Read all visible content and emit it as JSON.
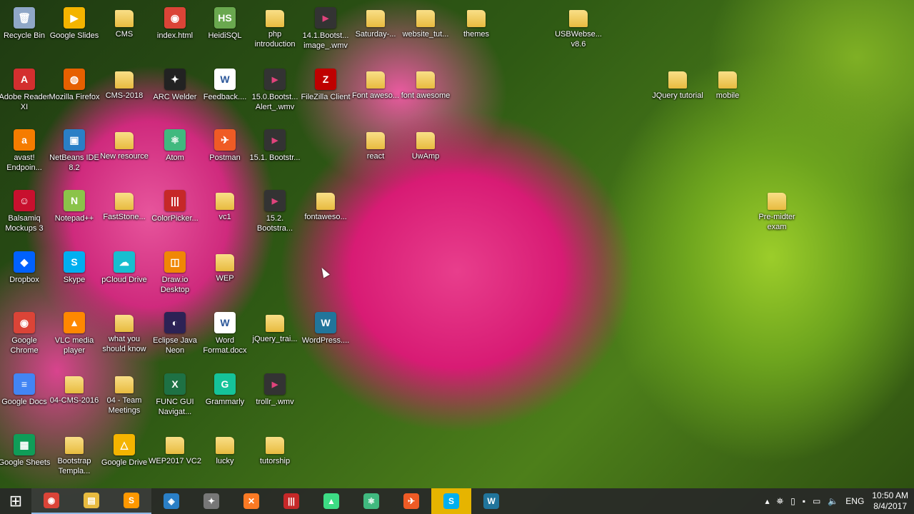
{
  "desktop_icons": [
    {
      "label": "Recycle Bin",
      "kind": "app",
      "glyph": "🗑",
      "color": "#8fa7c7"
    },
    {
      "label": "Google Slides",
      "kind": "app",
      "glyph": "▶",
      "color": "#f4b400"
    },
    {
      "label": "CMS",
      "kind": "folder"
    },
    {
      "label": "index.html",
      "kind": "app",
      "glyph": "◉",
      "color": "#db4437"
    },
    {
      "label": "HeidiSQL",
      "kind": "app",
      "glyph": "HS",
      "color": "#6aa84f"
    },
    {
      "label": "php introduction",
      "kind": "folder"
    },
    {
      "label": "14.1.Bootst... image_.wmv",
      "kind": "video",
      "glyph": "▶"
    },
    {
      "label": "Saturday-...",
      "kind": "folder"
    },
    {
      "label": "website_tut...",
      "kind": "folder"
    },
    {
      "label": "themes",
      "kind": "folder"
    },
    {
      "label": "USBWebse... v8.6",
      "kind": "folder"
    },
    {
      "label": "Adobe Reader XI",
      "kind": "app",
      "glyph": "A",
      "color": "#d32f2f"
    },
    {
      "label": "Mozilla Firefox",
      "kind": "app",
      "glyph": "◍",
      "color": "#e66000"
    },
    {
      "label": "CMS-2018",
      "kind": "folder"
    },
    {
      "label": "ARC Welder",
      "kind": "app",
      "glyph": "✦",
      "color": "#222"
    },
    {
      "label": "Feedback....",
      "kind": "doc",
      "glyph": "W"
    },
    {
      "label": "15.0.Bootst... Alert_.wmv",
      "kind": "video",
      "glyph": "▶"
    },
    {
      "label": "FileZilla Client",
      "kind": "app",
      "glyph": "Z",
      "color": "#bf0000"
    },
    {
      "label": "Font aweso...",
      "kind": "folder"
    },
    {
      "label": "font awesome",
      "kind": "folder"
    },
    {
      "label": "JQuery tutorial",
      "kind": "folder"
    },
    {
      "label": "mobile",
      "kind": "folder"
    },
    {
      "label": "avast! Endpoin...",
      "kind": "app",
      "glyph": "a",
      "color": "#f57c00"
    },
    {
      "label": "NetBeans IDE 8.2",
      "kind": "app",
      "glyph": "▣",
      "color": "#2a7fc6"
    },
    {
      "label": "New resource",
      "kind": "folder"
    },
    {
      "label": "Atom",
      "kind": "app",
      "glyph": "⚛",
      "color": "#40b97f"
    },
    {
      "label": "Postman",
      "kind": "app",
      "glyph": "✈",
      "color": "#ef5b25"
    },
    {
      "label": "15.1. Bootstr...",
      "kind": "video",
      "glyph": "▶"
    },
    {
      "label": "react",
      "kind": "folder"
    },
    {
      "label": "UwAmp",
      "kind": "folder"
    },
    {
      "label": "Balsamiq Mockups 3",
      "kind": "app",
      "glyph": "☺",
      "color": "#c8102e"
    },
    {
      "label": "Notepad++",
      "kind": "app",
      "glyph": "N",
      "color": "#8bc34a"
    },
    {
      "label": "FastStone...",
      "kind": "folder"
    },
    {
      "label": "ColorPicker...",
      "kind": "app",
      "glyph": "|||",
      "color": "#c62828"
    },
    {
      "label": "vc1",
      "kind": "folder"
    },
    {
      "label": "15.2. Bootstra...",
      "kind": "video",
      "glyph": "▶"
    },
    {
      "label": "fontaweso...",
      "kind": "folder"
    },
    {
      "label": "Pre-midter exam",
      "kind": "folder"
    },
    {
      "label": "Dropbox",
      "kind": "app",
      "glyph": "◆",
      "color": "#0061fe"
    },
    {
      "label": "Skype",
      "kind": "app",
      "glyph": "S",
      "color": "#00aff0"
    },
    {
      "label": "pCloud Drive",
      "kind": "app",
      "glyph": "☁",
      "color": "#17bed0"
    },
    {
      "label": "Draw.io Desktop",
      "kind": "app",
      "glyph": "◫",
      "color": "#f08705"
    },
    {
      "label": "WEP",
      "kind": "folder"
    },
    {
      "label": "Google Chrome",
      "kind": "app",
      "glyph": "◉",
      "color": "#db4437"
    },
    {
      "label": "VLC media player",
      "kind": "app",
      "glyph": "▲",
      "color": "#ff8800"
    },
    {
      "label": "what you should know",
      "kind": "folder"
    },
    {
      "label": "Eclipse Java Neon",
      "kind": "app",
      "glyph": "◐",
      "color": "#2c2255"
    },
    {
      "label": "Word Format.docx",
      "kind": "doc",
      "glyph": "W"
    },
    {
      "label": "jQuery_trai...",
      "kind": "folder"
    },
    {
      "label": "WordPress....",
      "kind": "app",
      "glyph": "W",
      "color": "#21759b"
    },
    {
      "label": "Google Docs",
      "kind": "app",
      "glyph": "≡",
      "color": "#4285f4"
    },
    {
      "label": "04-CMS-2016",
      "kind": "folder"
    },
    {
      "label": "04 - Team Meetings",
      "kind": "folder"
    },
    {
      "label": "FUNC GUI Navigat...",
      "kind": "app",
      "glyph": "X",
      "color": "#1e7145"
    },
    {
      "label": "Grammarly",
      "kind": "app",
      "glyph": "G",
      "color": "#15c39a"
    },
    {
      "label": "trollr_.wmv",
      "kind": "video",
      "glyph": "▶"
    },
    {
      "label": "Google Sheets",
      "kind": "app",
      "glyph": "▦",
      "color": "#0f9d58"
    },
    {
      "label": "Bootstrap Templa...",
      "kind": "folder"
    },
    {
      "label": "Google Drive",
      "kind": "app",
      "glyph": "△",
      "color": "#f4b400"
    },
    {
      "label": "WEP2017 VC2",
      "kind": "folder"
    },
    {
      "label": "lucky",
      "kind": "folder"
    },
    {
      "label": "tutorship",
      "kind": "folder"
    }
  ],
  "taskbar": {
    "start_glyph": "⊞",
    "apps": [
      {
        "name": "chrome",
        "glyph": "◉",
        "color": "#db4437",
        "active": true
      },
      {
        "name": "file-explorer",
        "glyph": "▤",
        "color": "#e8bb3f",
        "active": true
      },
      {
        "name": "sublime-text",
        "glyph": "S",
        "color": "#ff9800",
        "active": true
      },
      {
        "name": "netbeans",
        "glyph": "◈",
        "color": "#2a7fc6",
        "active": false
      },
      {
        "name": "arc-welder",
        "glyph": "✦",
        "color": "#777",
        "active": false
      },
      {
        "name": "xampp",
        "glyph": "✕",
        "color": "#fb7a24",
        "active": false
      },
      {
        "name": "colorpicker",
        "glyph": "|||",
        "color": "#c62828",
        "active": false
      },
      {
        "name": "android-studio",
        "glyph": "▲",
        "color": "#3ddc84",
        "active": false
      },
      {
        "name": "atom",
        "glyph": "⚛",
        "color": "#40b97f",
        "active": false
      },
      {
        "name": "postman",
        "glyph": "✈",
        "color": "#ef5b25",
        "active": false
      },
      {
        "name": "skype",
        "glyph": "S",
        "color": "#00aff0",
        "active": false,
        "highlight": true
      },
      {
        "name": "wordpress",
        "glyph": "W",
        "color": "#21759b",
        "active": false
      }
    ],
    "tray": {
      "language": "ENG",
      "time": "10:50 AM",
      "date": "8/4/2017"
    }
  }
}
